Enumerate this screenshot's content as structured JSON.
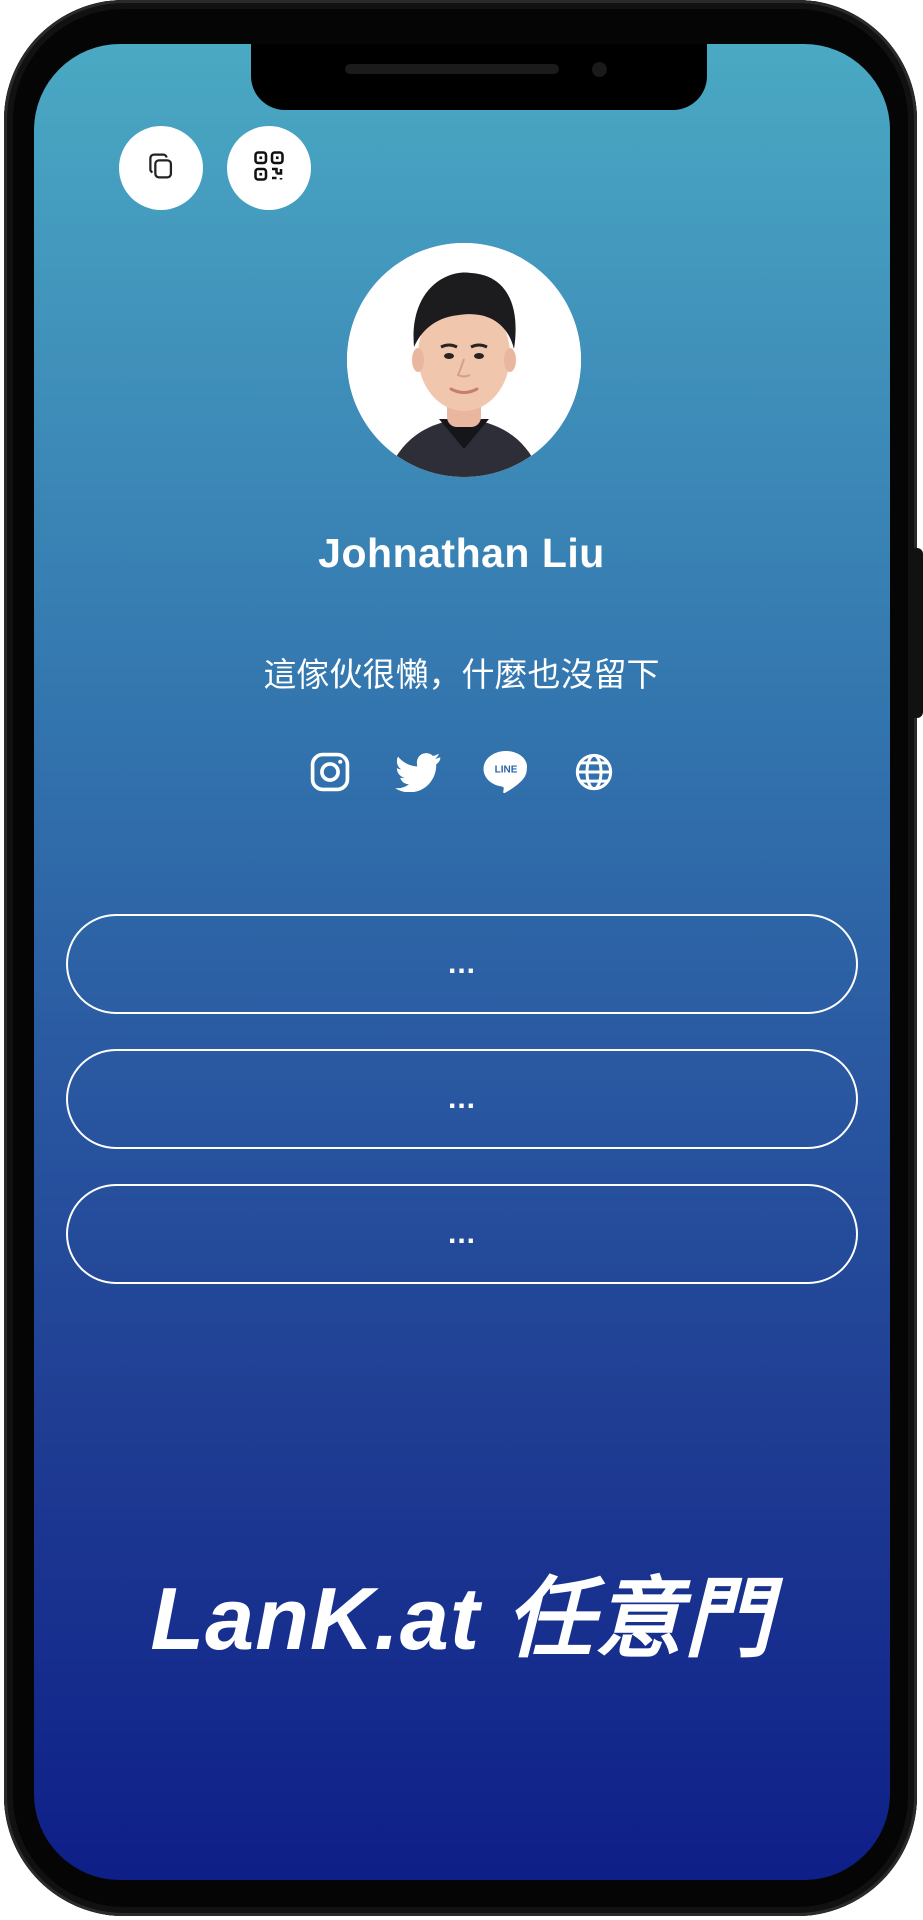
{
  "profile": {
    "name": "Johnathan Liu",
    "bio": "這傢伙很懶，什麼也沒留下"
  },
  "actions": {
    "copy_icon": "copy-icon",
    "qr_icon": "qr-code-icon"
  },
  "socials": [
    {
      "icon": "instagram-icon"
    },
    {
      "icon": "twitter-icon"
    },
    {
      "icon": "line-icon",
      "text": "LINE"
    },
    {
      "icon": "globe-icon"
    }
  ],
  "links": [
    {
      "label": "..."
    },
    {
      "label": "..."
    },
    {
      "label": "..."
    }
  ],
  "footer": {
    "brand": "LanK.at 任意門"
  },
  "colors": {
    "gradient_top": "#4aa9c3",
    "gradient_bottom": "#0e1f88",
    "text": "#ffffff"
  }
}
